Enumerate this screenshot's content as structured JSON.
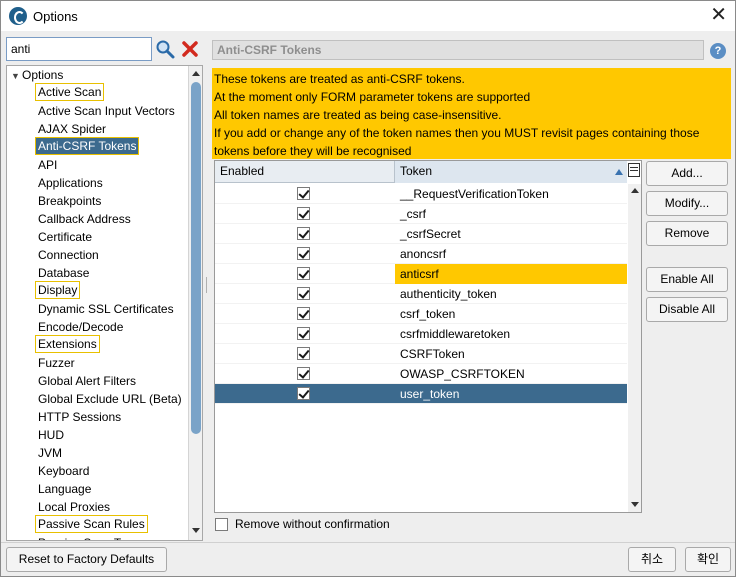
{
  "window": {
    "title": "Options"
  },
  "search": {
    "value": "anti"
  },
  "tree": {
    "root": "Options",
    "items": [
      {
        "label": "Active Scan",
        "state": "highlight"
      },
      {
        "label": "Active Scan Input Vectors",
        "state": ""
      },
      {
        "label": "AJAX Spider",
        "state": ""
      },
      {
        "label": "Anti-CSRF Tokens",
        "state": "selected"
      },
      {
        "label": "API",
        "state": ""
      },
      {
        "label": "Applications",
        "state": ""
      },
      {
        "label": "Breakpoints",
        "state": ""
      },
      {
        "label": "Callback Address",
        "state": ""
      },
      {
        "label": "Certificate",
        "state": ""
      },
      {
        "label": "Connection",
        "state": ""
      },
      {
        "label": "Database",
        "state": ""
      },
      {
        "label": "Display",
        "state": "highlight"
      },
      {
        "label": "Dynamic SSL Certificates",
        "state": ""
      },
      {
        "label": "Encode/Decode",
        "state": ""
      },
      {
        "label": "Extensions",
        "state": "highlight"
      },
      {
        "label": "Fuzzer",
        "state": ""
      },
      {
        "label": "Global Alert Filters",
        "state": ""
      },
      {
        "label": "Global Exclude URL (Beta)",
        "state": ""
      },
      {
        "label": "HTTP Sessions",
        "state": ""
      },
      {
        "label": "HUD",
        "state": ""
      },
      {
        "label": "JVM",
        "state": ""
      },
      {
        "label": "Keyboard",
        "state": ""
      },
      {
        "label": "Language",
        "state": ""
      },
      {
        "label": "Local Proxies",
        "state": ""
      },
      {
        "label": "Passive Scan Rules",
        "state": "highlight"
      },
      {
        "label": "Passive Scan Tags",
        "state": ""
      }
    ]
  },
  "panel": {
    "title": "Anti-CSRF Tokens",
    "notice": [
      "These tokens are treated as anti-CSRF tokens.",
      "At the moment only FORM parameter tokens are supported",
      "All token names are treated as being case-insensitive.",
      "If you add or change any of the token names then you MUST revisit pages containing those",
      "tokens before they will be recognised"
    ]
  },
  "table": {
    "columns": [
      "Enabled",
      "Token"
    ],
    "rows": [
      {
        "enabled": true,
        "token": "__RequestVerificationToken",
        "state": ""
      },
      {
        "enabled": true,
        "token": "_csrf",
        "state": ""
      },
      {
        "enabled": true,
        "token": "_csrfSecret",
        "state": ""
      },
      {
        "enabled": true,
        "token": "anoncsrf",
        "state": ""
      },
      {
        "enabled": true,
        "token": "anticsrf",
        "state": "highlight"
      },
      {
        "enabled": true,
        "token": "authenticity_token",
        "state": ""
      },
      {
        "enabled": true,
        "token": "csrf_token",
        "state": ""
      },
      {
        "enabled": true,
        "token": "csrfmiddlewaretoken",
        "state": ""
      },
      {
        "enabled": true,
        "token": "CSRFToken",
        "state": ""
      },
      {
        "enabled": true,
        "token": "OWASP_CSRFTOKEN",
        "state": ""
      },
      {
        "enabled": true,
        "token": "user_token",
        "state": "selected"
      }
    ]
  },
  "buttons": {
    "add": "Add...",
    "modify": "Modify...",
    "remove": "Remove",
    "enable_all": "Enable All",
    "disable_all": "Disable All",
    "reset": "Reset to Factory Defaults",
    "cancel": "취소",
    "ok": "확인"
  },
  "remove_confirm": {
    "label": "Remove without confirmation",
    "checked": false
  },
  "colors": {
    "accent_yellow": "#ffc800",
    "selection_blue": "#3c6a8e"
  }
}
